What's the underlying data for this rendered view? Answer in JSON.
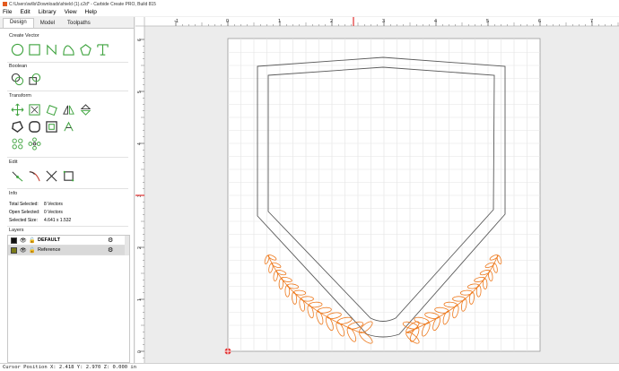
{
  "window": {
    "title": "C:\\Users\\wills\\Downloads\\shield (1).c2d* - Carbide Create PRO, Build 815"
  },
  "menu": {
    "file": "File",
    "edit": "Edit",
    "library": "Library",
    "view": "View",
    "help": "Help"
  },
  "tabs": {
    "design": "Design",
    "model": "Model",
    "toolpaths": "Toolpaths"
  },
  "sections": {
    "create_vector": "Create Vector",
    "boolean": "Boolean",
    "transform": "Transform",
    "edit": "Edit",
    "info": "Info",
    "layers": "Layers"
  },
  "info": {
    "total_selected_label": "Total Selected:",
    "total_selected_value": "8 Vectors",
    "open_selected_label": "Open Selected:",
    "open_selected_value": "0 Vectors",
    "selected_size_label": "Selected Size:",
    "selected_size_value": "4.641 x 1.532"
  },
  "layers": [
    {
      "name": "DEFAULT",
      "color": "#111111"
    },
    {
      "name": "Reference",
      "color": "#7a7a18"
    }
  ],
  "ruler": {
    "x_ticks": [
      "-1",
      "0",
      "1",
      "2",
      "3",
      "4",
      "5",
      "6",
      "7"
    ],
    "y_ticks": [
      "6",
      "5",
      "4",
      "3",
      "2",
      "1",
      "0"
    ]
  },
  "status": {
    "cursor": "Cursor Position X: 2.418 Y: 2.970 Z: 0.000 in"
  },
  "colors": {
    "accent_green": "#3fa33f",
    "vector_orange": "#ee7a1e",
    "marker_red": "#e03030",
    "outline": "#5a5a5a"
  }
}
